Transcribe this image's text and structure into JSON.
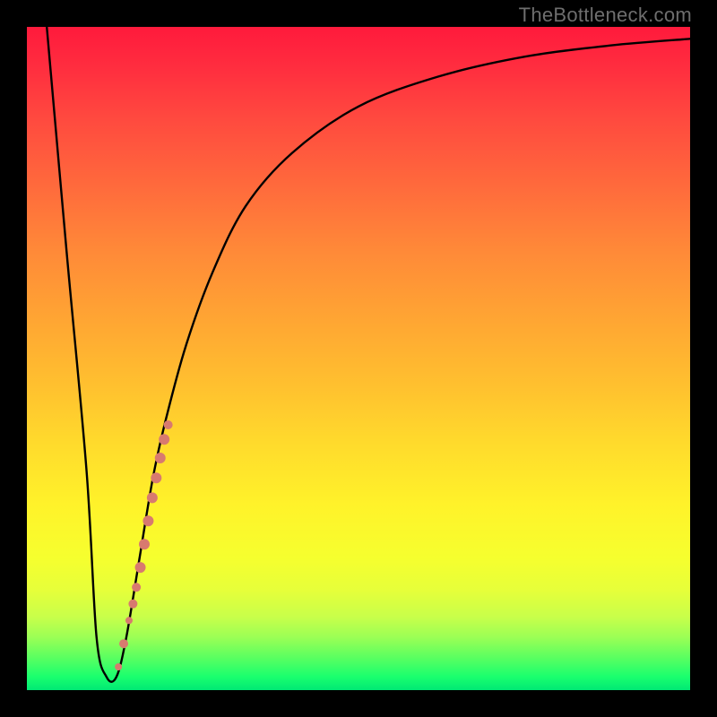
{
  "watermark": "TheBottleneck.com",
  "colors": {
    "curve": "#000000",
    "marker": "#d87a6f",
    "frame": "#000000"
  },
  "chart_data": {
    "type": "line",
    "title": "",
    "xlabel": "",
    "ylabel": "",
    "xlim": [
      0,
      100
    ],
    "ylim": [
      0,
      100
    ],
    "series": [
      {
        "name": "bottleneck-curve",
        "x": [
          3,
          6,
          9,
          10.5,
          12,
          13.5,
          15,
          17,
          19,
          21,
          24,
          28,
          33,
          40,
          50,
          62,
          75,
          88,
          100
        ],
        "y": [
          100,
          66,
          33,
          8,
          2,
          2,
          8,
          20,
          32,
          41,
          52,
          63,
          73,
          81,
          88,
          92.5,
          95.5,
          97.2,
          98.2
        ]
      }
    ],
    "markers": {
      "name": "highlighted-segment",
      "points": [
        {
          "x": 13.8,
          "y": 3.5,
          "r": 4
        },
        {
          "x": 14.6,
          "y": 7.0,
          "r": 5
        },
        {
          "x": 15.4,
          "y": 10.5,
          "r": 4
        },
        {
          "x": 16.0,
          "y": 13.0,
          "r": 5
        },
        {
          "x": 16.5,
          "y": 15.5,
          "r": 5
        },
        {
          "x": 17.1,
          "y": 18.5,
          "r": 6
        },
        {
          "x": 17.7,
          "y": 22.0,
          "r": 6
        },
        {
          "x": 18.3,
          "y": 25.5,
          "r": 6
        },
        {
          "x": 18.9,
          "y": 29.0,
          "r": 6
        },
        {
          "x": 19.5,
          "y": 32.0,
          "r": 6
        },
        {
          "x": 20.1,
          "y": 35.0,
          "r": 6
        },
        {
          "x": 20.7,
          "y": 37.8,
          "r": 6
        },
        {
          "x": 21.3,
          "y": 40.0,
          "r": 5
        }
      ]
    }
  }
}
